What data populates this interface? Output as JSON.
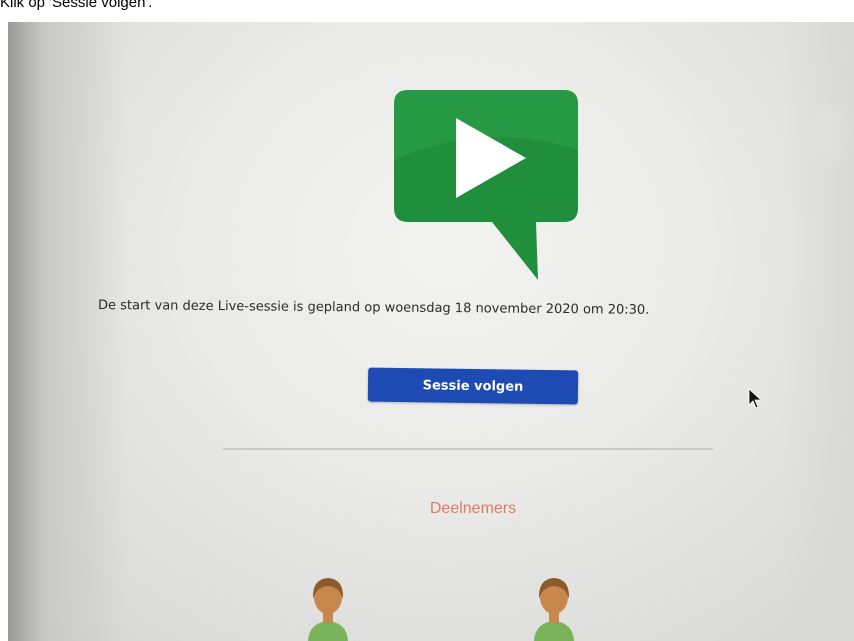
{
  "caption": {
    "text": "Klik op 'Sessie volgen'."
  },
  "session": {
    "schedule_text": "De start van deze Live-sessie is gepland op woensdag 18 november 2020 om 20:30.",
    "follow_button_label": "Sessie volgen"
  },
  "participants": {
    "heading": "Deelnemers"
  },
  "icons": {
    "logo": "play-speech-bubble-icon",
    "participant": "user-avatar-icon",
    "cursor": "mouse-pointer-icon"
  },
  "colors": {
    "logo_green": "#1f8f3d",
    "button_blue": "#1d4bb3",
    "heading_salmon": "#de7a6b",
    "avatar_skin": "#c8874d",
    "avatar_shirt": "#79b45a"
  }
}
